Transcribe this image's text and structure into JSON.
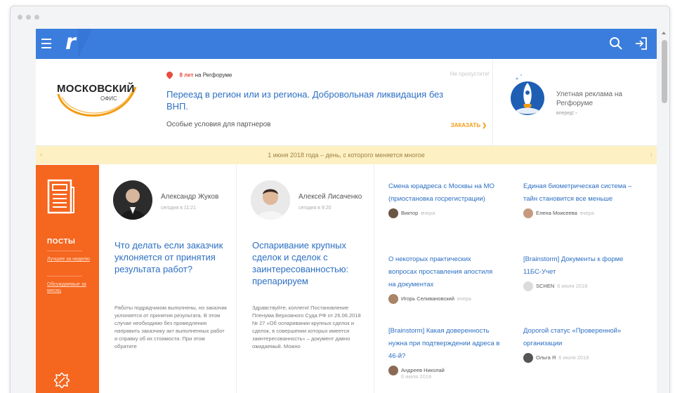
{
  "header": {
    "logo_letter": "r"
  },
  "promo": {
    "logo_line1": "МОСКОВСКИЙ",
    "logo_line2": "ОФИС",
    "years_count": "8 лет",
    "years_text": "на Регфоруме",
    "hint": "Не пропустите!",
    "title": "Переезд в регион или из региона. Добровольная ликвидация без ВНП.",
    "subtitle": "Особые условия для партнеров",
    "order": "ЗАКАЗАТЬ ❯",
    "right_title": "Улетная реклама на Регфоруме",
    "right_link": "вперед! ›"
  },
  "strip": {
    "text": "1 июня 2018 года – день, с которого меняется многое",
    "prev": "‹",
    "next": "›"
  },
  "sidebar": {
    "section": "ПОСТЫ",
    "link1": "Лучшее за неделю",
    "link2": "Обсуждаемые за месяц"
  },
  "posts": [
    {
      "author": "Александр Жуков",
      "time": "сегодня в 11:21",
      "title": "Что делать если заказчик уклоняется от принятия результата работ?",
      "excerpt": "Работы подрядчиком выполнены, но заказчик уклоняется от принятия результата. В этом случае необходимо без промедления направить заказчику акт выполненных работ и справку об их стоимости. При этом обратите"
    },
    {
      "author": "Алексей Лисаченко",
      "time": "сегодня в 9:20",
      "title": "Оспаривание крупных сделок и сделок с заинтересованностью: препарируем",
      "excerpt": "Здравствуйте, коллеги! Постановление Пленума Верховного Суда РФ от 26.06.2018 № 27 «Об оспаривании крупных сделок и сделок, в совершении которых имеется заинтересованность» – документ давно ожидаемый. Можно"
    }
  ],
  "news_left": [
    {
      "tag": "",
      "title": "Смена юрадреса с Москвы на МО (приостановка госрегистрации)",
      "author": "Виктор",
      "date": "вчера"
    },
    {
      "tag": "",
      "title": "О некоторых практических вопросах проставления апостиля на документах",
      "author": "Игорь Селивановский",
      "date": "вчера"
    },
    {
      "tag": "[Brainstorm]",
      "title": "Какая доверенность нужна при подтверждении адреса в 46-й?",
      "author": "Андреев Николай",
      "date": "6 июля 2018"
    }
  ],
  "news_right": [
    {
      "tag": "",
      "title": "Единая биометрическая система – тайн становится все меньше",
      "author": "Елена Моисеева",
      "date": "вчера"
    },
    {
      "tag": "[Brainstorm]",
      "title": "Документы к форме 11БС-Учет",
      "author": "SCHEN",
      "date": "6 июля 2018"
    },
    {
      "tag": "",
      "title": "Дорогой статус «Проверенной» организации",
      "author": "Ольга Я",
      "date": "6 июля 2018"
    }
  ],
  "colors": {
    "brand_blue": "#3b7ddd",
    "orange": "#f5661f",
    "link": "#2d6fc3",
    "strip_bg": "#fdf0c2"
  }
}
